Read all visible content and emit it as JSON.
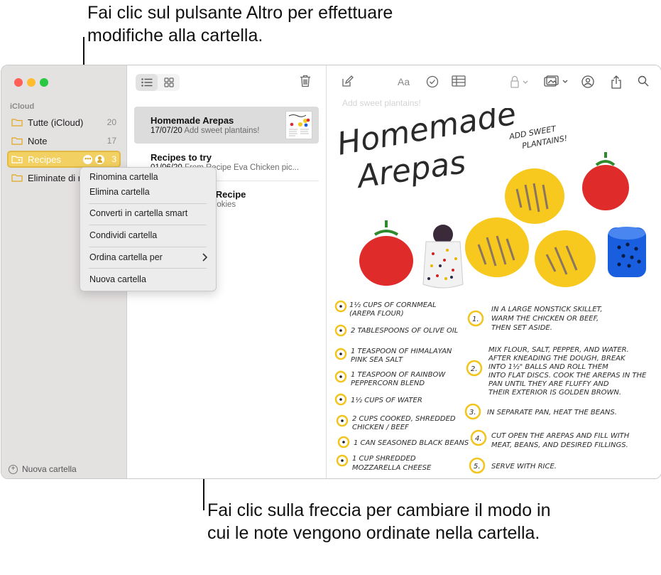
{
  "callouts": {
    "top_text": "Fai clic sul pulsante Altro per effettuare modifiche alla cartella.",
    "bottom_text": "Fai clic sulla freccia per cambiare il modo in cui le note vengono ordinate nella cartella."
  },
  "sidebar": {
    "section_label": "iCloud",
    "folders": [
      {
        "name": "Tutte (iCloud)",
        "count": "20"
      },
      {
        "name": "Note",
        "count": "17"
      },
      {
        "name": "Recipes",
        "count": "3"
      },
      {
        "name": "Eliminate di recente",
        "count": ""
      }
    ],
    "new_folder_label": "Nuova cartella"
  },
  "context_menu": {
    "items": [
      "Rinomina cartella",
      "Elimina cartella",
      "Converti in cartella smart",
      "Condividi cartella",
      "Ordina cartella per",
      "Nuova cartella"
    ]
  },
  "notes": [
    {
      "title": "Homemade Arepas",
      "date": "17/07/20",
      "preview": "Add sweet plantains!"
    },
    {
      "title": "Recipes to try",
      "date": "01/06/20",
      "preview": "From Recipe Eva Chicken pic..."
    },
    {
      "title": "Family Cookie Recipe",
      "date": "",
      "preview": "Makes 4 dozen cookies"
    }
  ],
  "editor": {
    "faded_text": "Add sweet plantains!",
    "handwriting": {
      "title_line1": "Homemade",
      "title_line2": "Arepas",
      "add_note_line1": "ADD SWEET",
      "add_note_line2": "PLANTAINS!",
      "ingredients": [
        "1½ CUPS OF CORNMEAL",
        "(AREPA FLOUR)",
        "2 TABLESPOONS OF OLIVE OIL",
        "1 TEASPOON OF HIMALAYAN",
        "PINK SEA SALT",
        "1 TEASPOON OF RAINBOW",
        "PEPPERCORN BLEND",
        "1½ CUPS OF WATER",
        "2 CUPS COOKED, SHREDDED",
        "CHICKEN / BEEF",
        "1 CAN SEASONED BLACK BEANS",
        "1 CUP SHREDDED",
        "MOZZARELLA CHEESE"
      ],
      "steps": [
        {
          "num": "1.",
          "lines": [
            "IN A LARGE NONSTICK SKILLET,",
            "WARM THE CHICKEN OR BEEF,",
            "THEN SET ASIDE."
          ]
        },
        {
          "num": "2.",
          "lines": [
            "MIX FLOUR, SALT, PEPPER, AND WATER.",
            "AFTER KNEADING THE DOUGH, BREAK",
            "INTO 1½\" BALLS AND ROLL THEM",
            "INTO FLAT DISCS. COOK THE AREPAS IN THE",
            "PAN UNTIL THEY ARE FLUFFY AND",
            "THEIR EXTERIOR IS GOLDEN BROWN."
          ]
        },
        {
          "num": "3.",
          "lines": [
            "IN SEPARATE PAN, HEAT THE BEANS."
          ]
        },
        {
          "num": "4.",
          "lines": [
            "CUT OPEN THE AREPAS AND FILL WITH",
            "MEAT, BEANS, AND DESIRED FILLINGS."
          ]
        },
        {
          "num": "5.",
          "lines": [
            "SERVE WITH RICE."
          ]
        }
      ]
    }
  },
  "colors": {
    "accent_yellow": "#f2d061",
    "sidebar_bg": "#e4e1e1",
    "tomato_red": "#e02b2b",
    "arepa_yellow": "#f7c81e",
    "jar_blue": "#1a5ee0"
  }
}
